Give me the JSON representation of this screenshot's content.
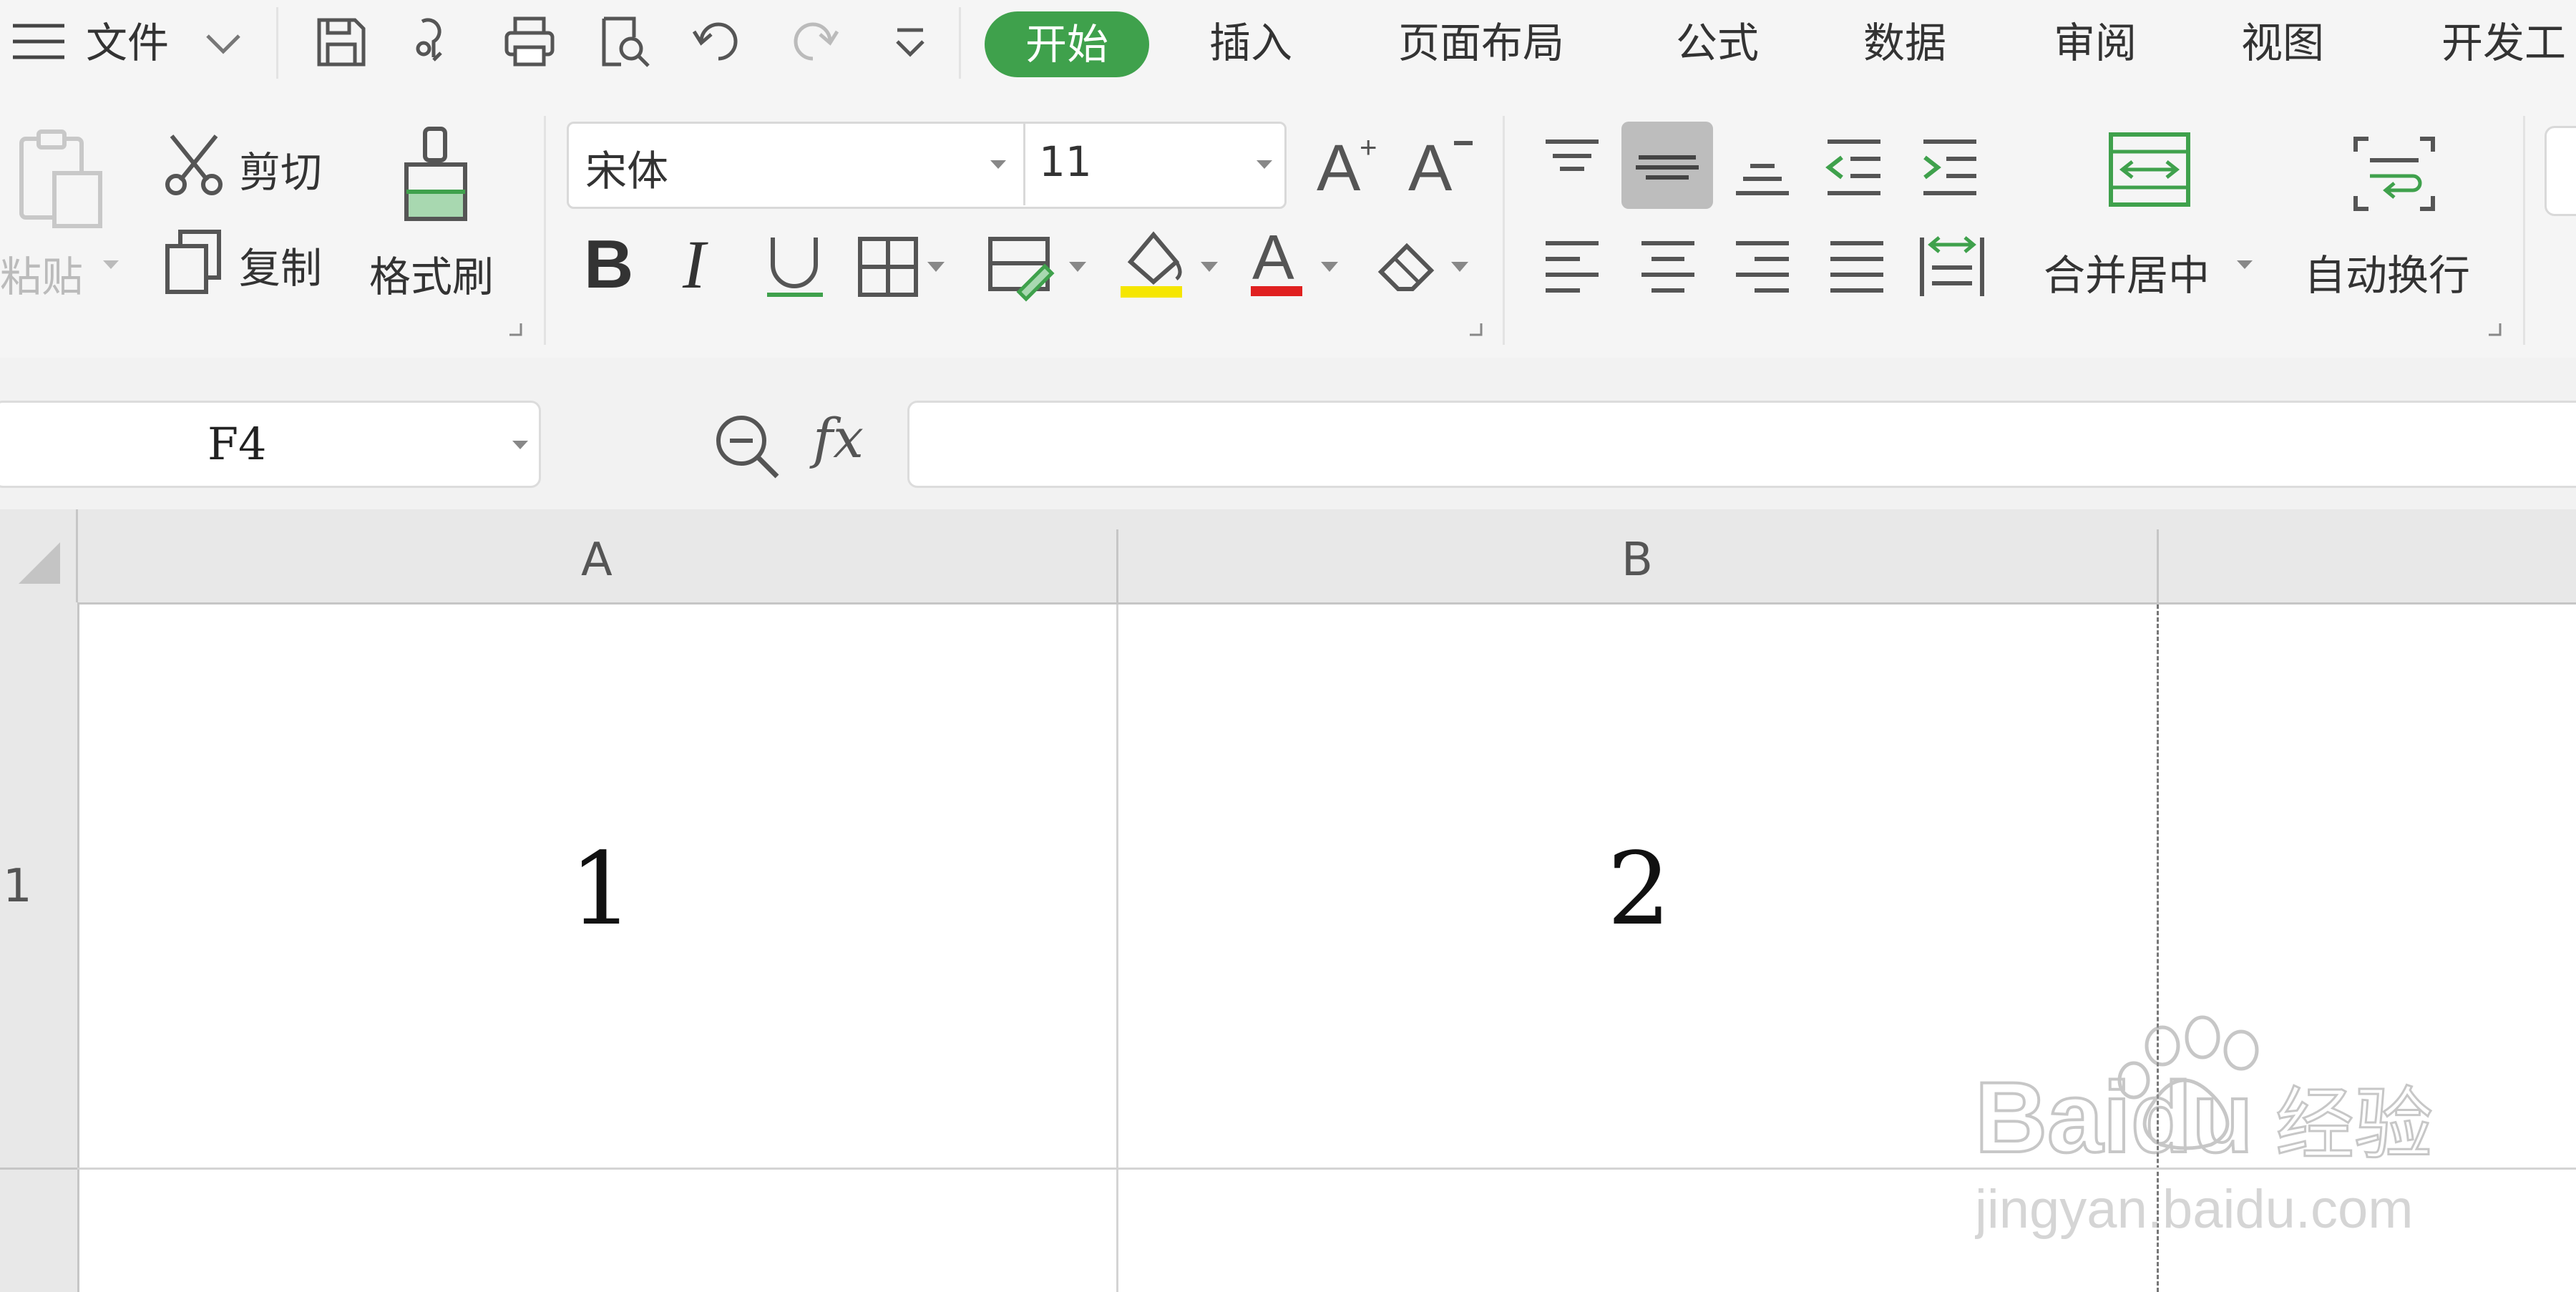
{
  "titlebar": {
    "menu_label": "文件",
    "tabs": [
      "开始",
      "插入",
      "页面布局",
      "公式",
      "数据",
      "审阅",
      "视图",
      "开发工"
    ],
    "quick_access": [
      "save-icon",
      "format-painter-icon",
      "print-icon",
      "print-preview-icon",
      "undo-icon",
      "redo-icon",
      "customize-icon"
    ]
  },
  "ribbon": {
    "clipboard": {
      "paste": "粘贴",
      "cut": "剪切",
      "copy": "复制",
      "format_painter": "格式刷"
    },
    "font": {
      "name": "宋体",
      "size": "11"
    },
    "alignment": {
      "merge_center": "合并居中",
      "wrap_text": "自动换行"
    }
  },
  "formula_bar": {
    "cell_ref": "F4",
    "fx": "fx",
    "value": ""
  },
  "sheet": {
    "columns": [
      "A",
      "B"
    ],
    "rows": [
      "1"
    ],
    "cells": {
      "A1": "1",
      "B1": "2"
    }
  },
  "watermark": {
    "brand": "Baidu",
    "brand_cn": "经验",
    "url": "jingyan.baidu.com"
  },
  "colors": {
    "accent": "#3fa14c",
    "font_color_bar": "#e02020",
    "fill_color_bar": "#f5e600"
  }
}
